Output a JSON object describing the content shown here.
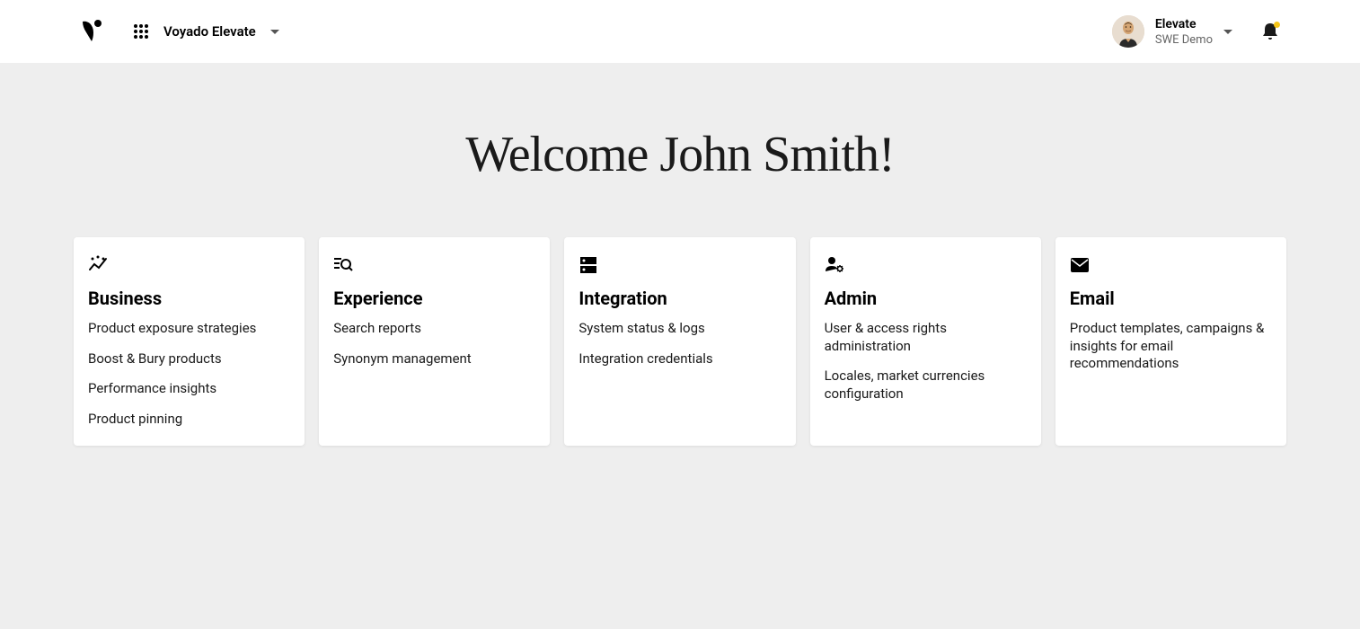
{
  "header": {
    "app_name": "Voyado Elevate",
    "account": {
      "name": "Elevate",
      "sub": "SWE Demo"
    }
  },
  "main": {
    "welcome_title": "Welcome John Smith!"
  },
  "cards": [
    {
      "title": "Business",
      "items": [
        "Product exposure strategies",
        "Boost & Bury products",
        "Performance insights",
        "Product pinning"
      ]
    },
    {
      "title": "Experience",
      "items": [
        "Search reports",
        "Synonym management"
      ]
    },
    {
      "title": "Integration",
      "items": [
        "System status & logs",
        "Integration credentials"
      ]
    },
    {
      "title": "Admin",
      "items": [
        "User & access rights administration",
        "Locales, market currencies configuration"
      ]
    },
    {
      "title": "Email",
      "items": [
        "Product templates, campaigns & insights for email recommendations"
      ]
    }
  ]
}
